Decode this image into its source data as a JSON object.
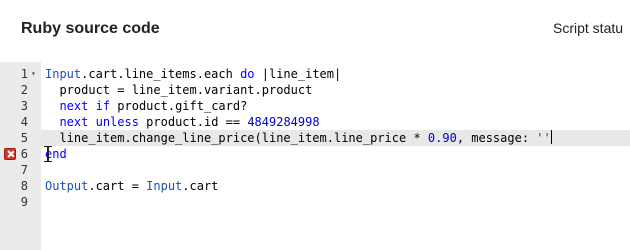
{
  "header": {
    "title": "Ruby source code",
    "status_label": "Script statu"
  },
  "editor": {
    "lines": [
      {
        "num": "1",
        "tokens": [
          {
            "t": "Input",
            "c": "cls"
          },
          {
            "t": ".cart.line_items.each ",
            "c": ""
          },
          {
            "t": "do",
            "c": "kw"
          },
          {
            "t": " |line_item|",
            "c": ""
          }
        ]
      },
      {
        "num": "2",
        "tokens": [
          {
            "t": "  product = line_item.variant.product",
            "c": ""
          }
        ]
      },
      {
        "num": "3",
        "tokens": [
          {
            "t": "  ",
            "c": ""
          },
          {
            "t": "next",
            "c": "kw"
          },
          {
            "t": " ",
            "c": ""
          },
          {
            "t": "if",
            "c": "kw"
          },
          {
            "t": " product.gift_card?",
            "c": ""
          }
        ]
      },
      {
        "num": "4",
        "tokens": [
          {
            "t": "  ",
            "c": ""
          },
          {
            "t": "next",
            "c": "kw"
          },
          {
            "t": " ",
            "c": ""
          },
          {
            "t": "unless",
            "c": "kw"
          },
          {
            "t": " product.id == ",
            "c": ""
          },
          {
            "t": "4849284998",
            "c": "num"
          }
        ]
      },
      {
        "num": "5",
        "tokens": [
          {
            "t": "  line_item.change_line_price(line_item.line_price * ",
            "c": ""
          },
          {
            "t": "0.90",
            "c": "num"
          },
          {
            "t": ", message: ",
            "c": ""
          },
          {
            "t": "''",
            "c": "str"
          }
        ]
      },
      {
        "num": "6",
        "tokens": [
          {
            "t": "end",
            "c": "kw"
          }
        ]
      },
      {
        "num": "7",
        "tokens": []
      },
      {
        "num": "8",
        "tokens": [
          {
            "t": "Output",
            "c": "cls"
          },
          {
            "t": ".cart = ",
            "c": ""
          },
          {
            "t": "Input",
            "c": "cls"
          },
          {
            "t": ".cart",
            "c": ""
          }
        ]
      },
      {
        "num": "9",
        "tokens": []
      }
    ],
    "active_line": 5,
    "error_line": 6,
    "fold_line": 1
  }
}
